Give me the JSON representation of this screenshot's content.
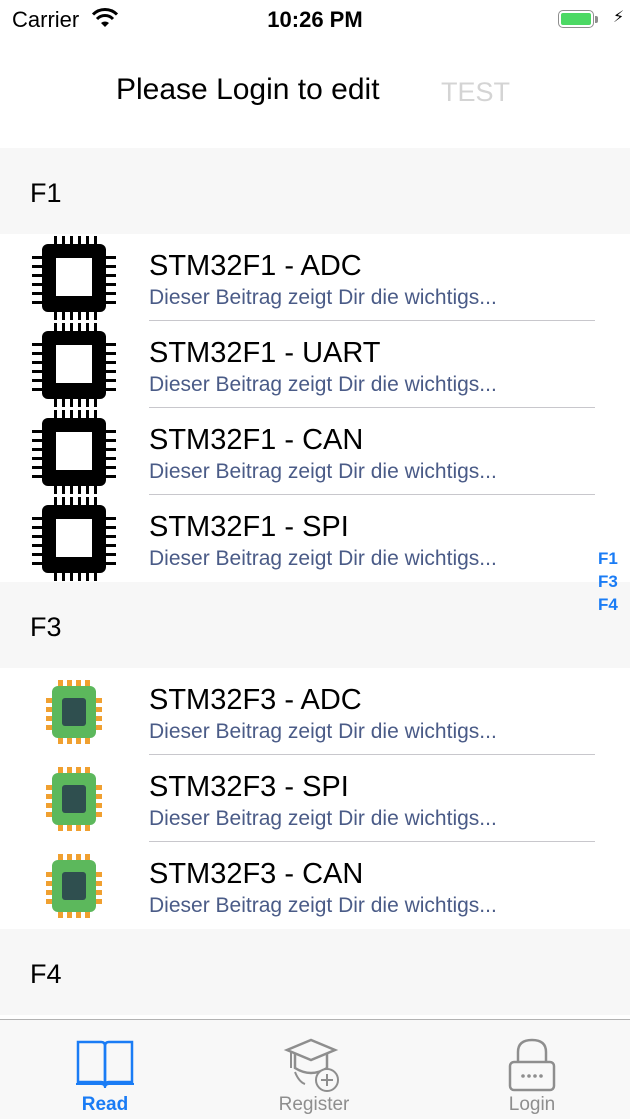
{
  "status_bar": {
    "carrier": "Carrier",
    "time": "10:26 PM",
    "battery_level": 1.0
  },
  "nav": {
    "title": "Please Login to edit",
    "action": "TEST"
  },
  "sections": [
    {
      "header": "F1",
      "icon": "black-chip-icon",
      "rows": [
        {
          "title": "STM32F1 - ADC",
          "subtitle": "Dieser Beitrag zeigt Dir die wichtigs..."
        },
        {
          "title": "STM32F1 - UART",
          "subtitle": "Dieser Beitrag zeigt Dir die wichtigs..."
        },
        {
          "title": "STM32F1 - CAN",
          "subtitle": "Dieser Beitrag zeigt Dir die wichtigs..."
        },
        {
          "title": "STM32F1 - SPI",
          "subtitle": "Dieser Beitrag zeigt Dir die wichtigs..."
        }
      ]
    },
    {
      "header": "F3",
      "icon": "green-chip-icon",
      "rows": [
        {
          "title": "STM32F3 - ADC",
          "subtitle": "Dieser Beitrag zeigt Dir die wichtigs..."
        },
        {
          "title": "STM32F3 - SPI",
          "subtitle": "Dieser Beitrag zeigt Dir die wichtigs..."
        },
        {
          "title": "STM32F3 - CAN",
          "subtitle": "Dieser Beitrag zeigt Dir die wichtigs..."
        }
      ]
    },
    {
      "header": "F4",
      "icon": "blue-chip-icon",
      "rows": []
    }
  ],
  "section_index": [
    "F1",
    "F3",
    "F4"
  ],
  "tabs": [
    {
      "label": "Read",
      "icon": "book-icon",
      "active": true
    },
    {
      "label": "Register",
      "icon": "graduation-cap-icon",
      "active": false
    },
    {
      "label": "Login",
      "icon": "lock-icon",
      "active": false
    }
  ],
  "colors": {
    "accent": "#1a7cf5",
    "subtitle": "#4a5b87",
    "section_bg": "#f7f7f7",
    "battery": "#4cd964",
    "chip_green": "#5cb85c",
    "chip_pins": "#f0a030"
  }
}
